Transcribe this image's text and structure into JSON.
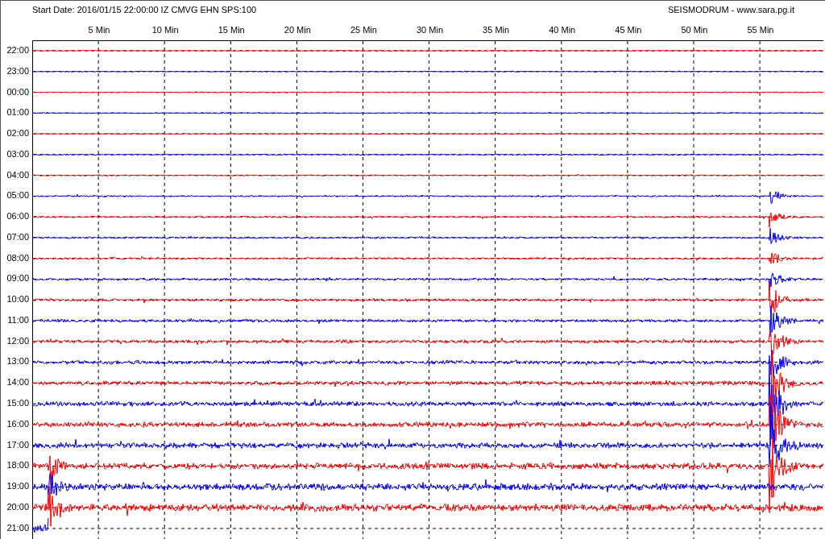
{
  "header": {
    "start_date": "Start Date: 2016/01/15 22:00:00 IZ CMVG EHN SPS:100",
    "title": "SEISMODRUM - www.sara.pg.it"
  },
  "minute_labels": [
    "5 Min",
    "10 Min",
    "15 Min",
    "20 Min",
    "25 Min",
    "30 Min",
    "35 Min",
    "40 Min",
    "45 Min",
    "50 Min",
    "55 Min"
  ],
  "rows": [
    {
      "label": "22:00",
      "color": "#ff0000"
    },
    {
      "label": "23:00",
      "color": "#0000ff"
    },
    {
      "label": "00:00",
      "color": "#ff0000"
    },
    {
      "label": "01:00",
      "color": "#0000ff"
    },
    {
      "label": "02:00",
      "color": "#ff0000"
    },
    {
      "label": "03:00",
      "color": "#0000ff"
    },
    {
      "label": "04:00",
      "color": "#ff0000"
    },
    {
      "label": "05:00",
      "color": "#0000ff"
    },
    {
      "label": "06:00",
      "color": "#ff0000"
    },
    {
      "label": "07:00",
      "color": "#0000ff"
    },
    {
      "label": "08:00",
      "color": "#ff0000"
    },
    {
      "label": "09:00",
      "color": "#0000ff"
    },
    {
      "label": "10:00",
      "color": "#ff0000"
    },
    {
      "label": "11:00",
      "color": "#0000ff"
    },
    {
      "label": "12:00",
      "color": "#ff0000"
    },
    {
      "label": "13:00",
      "color": "#0000ff"
    },
    {
      "label": "14:00",
      "color": "#ff0000"
    },
    {
      "label": "15:00",
      "color": "#0000ff"
    },
    {
      "label": "16:00",
      "color": "#ff0000"
    },
    {
      "label": "17:00",
      "color": "#0000ff"
    },
    {
      "label": "18:00",
      "color": "#ff0000"
    },
    {
      "label": "19:00",
      "color": "#0000ff"
    },
    {
      "label": "20:00",
      "color": "#ff0000"
    },
    {
      "label": "21:00",
      "color": "#0000ff"
    }
  ]
}
